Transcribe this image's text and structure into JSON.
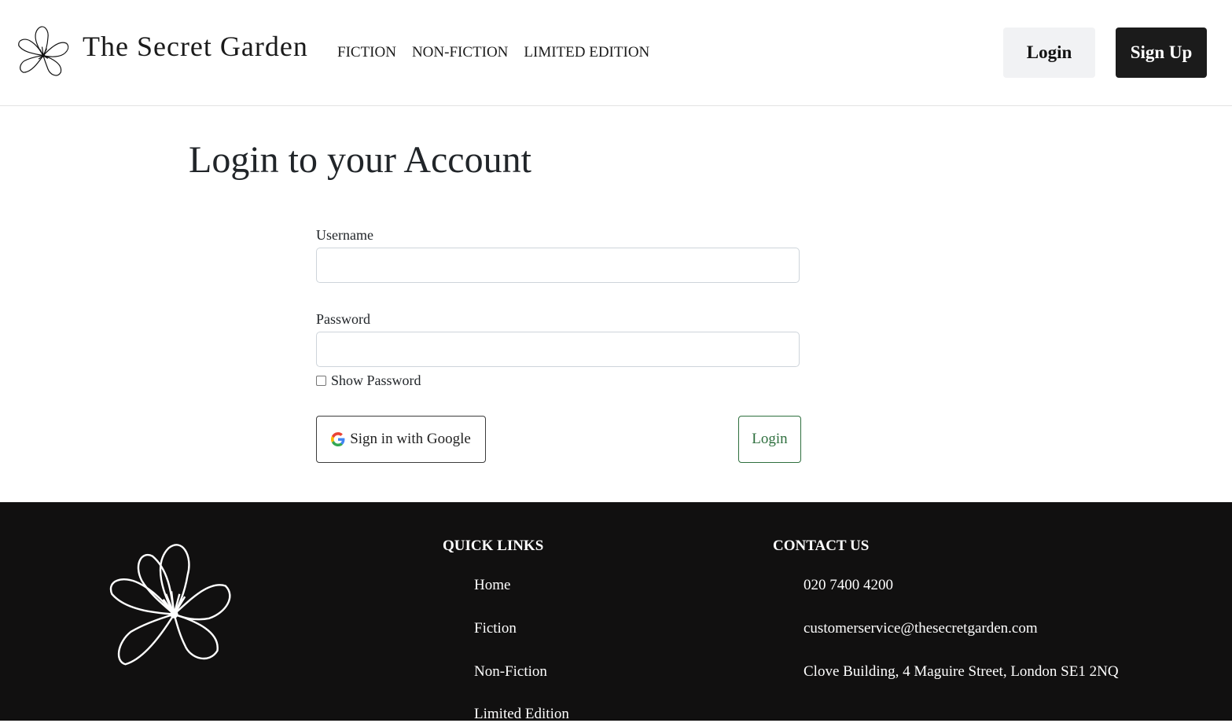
{
  "header": {
    "brand": "The Secret Garden",
    "logo_icon": "flower-icon",
    "nav": [
      "FICTION",
      "NON-FICTION",
      "LIMITED EDITION"
    ],
    "login_label": "Login",
    "signup_label": "Sign Up"
  },
  "main": {
    "title": "Login to your Account",
    "username_label": "Username",
    "username_value": "",
    "password_label": "Password",
    "password_value": "",
    "show_password_label": "Show Password",
    "show_password_checked": false,
    "google_button_label": "Sign in with Google",
    "google_icon": "google-icon",
    "login_button_label": "Login"
  },
  "footer": {
    "logo_icon": "flower-icon",
    "quick_links_heading": "QUICK LINKS",
    "quick_links": [
      "Home",
      "Fiction",
      "Non-Fiction",
      "Limited Edition"
    ],
    "contact_heading": "CONTACT US",
    "contact": {
      "phone": "020 7400 4200",
      "email": "customerservice@thesecretgarden.com",
      "address": "Clove Building, 4 Maguire Street, London SE1 2NQ"
    }
  },
  "colors": {
    "footer_bg": "#111010",
    "signup_bg": "#1b1b1b",
    "login_top_bg": "#f1f2f4",
    "login_form_accent": "#2e6f3e"
  }
}
